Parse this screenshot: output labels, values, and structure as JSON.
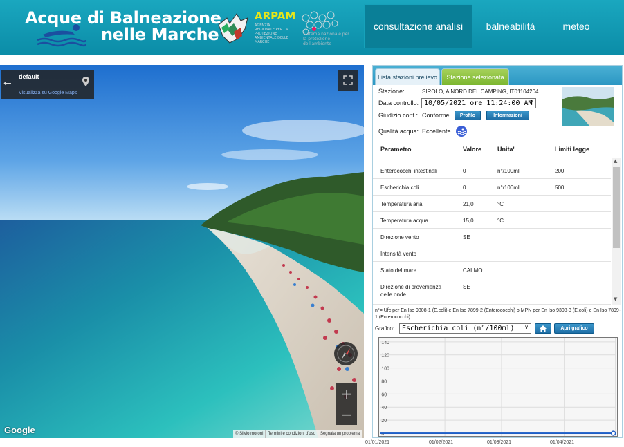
{
  "header": {
    "title_line1": "Acque di Balneazione",
    "title_line2": "nelle Marche",
    "logo_arpam": "ARPAM",
    "logo_arpam_sub": "AGENZIA REGIONALE PER LA PROTEZIONE AMBIENTALE DELLE MARCHE",
    "logo_snpa_sub": "Sistema nazionale per la protezione dell'ambiente",
    "nav": [
      {
        "label": "consultazione analisi",
        "active": true
      },
      {
        "label": "balneabilità",
        "active": false
      },
      {
        "label": "meteo",
        "active": false
      }
    ]
  },
  "streetview": {
    "location_name": "default",
    "maps_link": "Visualizza su Google Maps",
    "google_logo": "Google",
    "attribution": [
      "© Silvio moroni",
      "Termini e condizioni d'uso",
      "Segnala un problema"
    ],
    "zoom_in": "+",
    "zoom_out": "−"
  },
  "panel": {
    "tabs": [
      {
        "label": "Lista stazioni prelievo",
        "active": false
      },
      {
        "label": "Stazione selezionata",
        "active": true
      }
    ],
    "station_label": "Stazione:",
    "station_value": "SIROLO, A NORD DEL CAMPING, IT01104204...",
    "date_label": "Data controllo:",
    "date_value": "10/05/2021 ore 11:24:00 AM",
    "judgment_label": "Giudizio conf.:",
    "judgment_value": "Conforme",
    "profile_button": "Profilo",
    "info_button": "Informazioni",
    "quality_label": "Qualità acqua:",
    "quality_value": "Eccellente",
    "table": {
      "headers": [
        "Parametro",
        "Valore",
        "Unita'",
        "Limiti legge"
      ],
      "rows": [
        [
          "Enterococchi intestinali",
          "0",
          "n°/100ml",
          "200"
        ],
        [
          "Escherichia coli",
          "0",
          "n°/100ml",
          "500"
        ],
        [
          "Temperatura aria",
          "21,0",
          "°C",
          ""
        ],
        [
          "Temperatura acqua",
          "15,0",
          "°C",
          ""
        ],
        [
          "Direzione vento",
          "SE",
          "",
          ""
        ],
        [
          "Intensità vento",
          "",
          "",
          ""
        ],
        [
          "Stato del mare",
          "CALMO",
          "",
          ""
        ],
        [
          "Direzione di provenienza delle onde",
          "SE",
          "",
          ""
        ]
      ]
    },
    "note": "n°= Ufc per En Iso 9308-1 (E.coli) e En Iso 7899-2 (Enterococchi) o MPN per En Iso 9308-3 (E.coli) e En Iso 7899-1 (Enterococchi)",
    "chart_label": "Grafico:",
    "chart_select": "Escherichia coli (n°/100ml)",
    "open_chart_button": "Apri grafico"
  },
  "chart_data": {
    "type": "line",
    "title": "",
    "xlabel": "",
    "ylabel": "",
    "ylim": [
      0,
      140
    ],
    "yticks": [
      "140",
      "120",
      "100",
      "80",
      "60",
      "40",
      "20",
      "0"
    ],
    "xticks": [
      "01/01/2021",
      "01/02/2021",
      "01/03/2021",
      "01/04/2021"
    ],
    "series": [
      {
        "x": [
          "01/01/2021",
          "10/05/2021"
        ],
        "values": [
          0,
          0
        ]
      }
    ],
    "colors": {
      "line": "#1e5fc6",
      "fill": "#8fb4ea"
    }
  },
  "colors": {
    "header_bg": "#0b8ca7",
    "tab_active": "#7bb62f",
    "button": "#1f6ea6"
  }
}
